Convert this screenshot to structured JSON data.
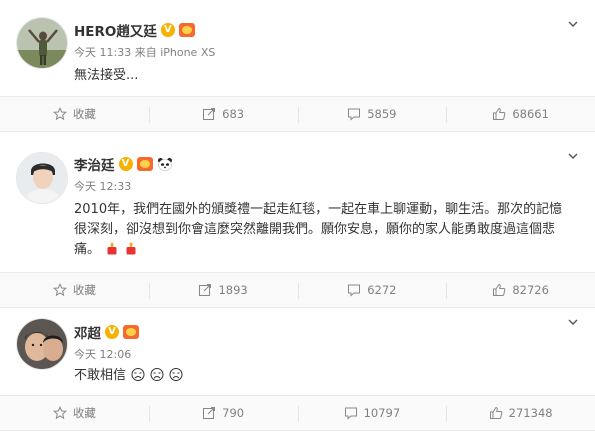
{
  "posts": [
    {
      "name": "HERO趙又廷",
      "time": "今天 11:33 来自 iPhone XS",
      "text": "無法接受...",
      "actions": {
        "favorite": "收藏",
        "repost": "683",
        "comment": "5859",
        "like": "68661"
      }
    },
    {
      "name": "李治廷",
      "time": "今天 12:33",
      "text": "2010年，我們在國外的頒獎禮一起走紅毯，一起在車上聊運動，聊生活。那次的記憶很深刻，卻沒想到你會這麼突然離開我們。願你安息，願你的家人能勇敢度過這個悲痛。",
      "actions": {
        "favorite": "收藏",
        "repost": "1893",
        "comment": "6272",
        "like": "82726"
      }
    },
    {
      "name": "邓超",
      "time": "今天 12:06",
      "text": "不敢相信",
      "actions": {
        "favorite": "收藏",
        "repost": "790",
        "comment": "10797",
        "like": "271348"
      }
    }
  ],
  "icons": [
    "chevron-down-icon",
    "star-icon",
    "repost-icon",
    "comment-icon",
    "like-icon",
    "verified-icon",
    "vip-badge-icon",
    "panda-icon",
    "candle-icon",
    "crying-icon"
  ],
  "colors": {
    "verified": "#f7b100",
    "vip": "#f56a2e",
    "meta": "#808080",
    "bar_bg": "#fafafa"
  }
}
